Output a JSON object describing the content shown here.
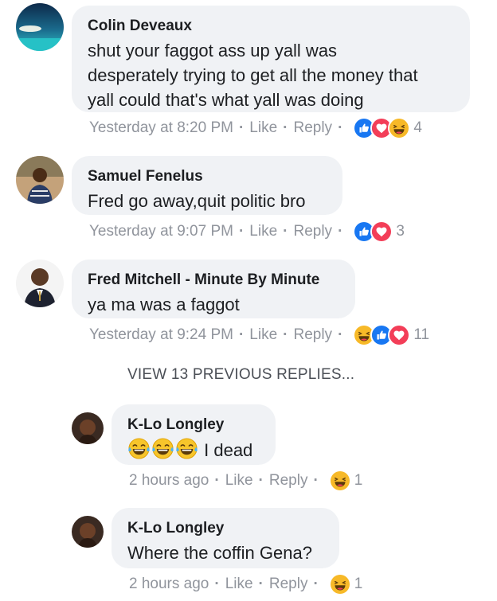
{
  "comments": [
    {
      "author": "Colin Deveaux",
      "text_lines": [
        "shut your faggot ass up yall was",
        "desperately trying to get all the money that",
        "yall could that's what yall was doing"
      ],
      "time": "Yesterday at 8:20 PM",
      "like": "Like",
      "reply": "Reply",
      "reactions": [
        "like",
        "love",
        "haha"
      ],
      "count": "4"
    },
    {
      "author": "Samuel Fenelus",
      "text_lines": [
        "Fred go away,quit politic bro"
      ],
      "time": "Yesterday at 9:07 PM",
      "like": "Like",
      "reply": "Reply",
      "reactions": [
        "like",
        "love"
      ],
      "count": "3"
    },
    {
      "author": "Fred Mitchell - Minute By Minute",
      "text_lines": [
        "ya ma was a faggot"
      ],
      "time": "Yesterday at 9:24 PM",
      "like": "Like",
      "reply": "Reply",
      "reactions": [
        "haha",
        "like",
        "love"
      ],
      "count": "11"
    }
  ],
  "view_previous": "VIEW 13 PREVIOUS REPLIES...",
  "replies": [
    {
      "author": "K-Lo Longley",
      "text": "I dead",
      "leading_emoji": [
        "laughing-tears",
        "laughing-tears",
        "laughing-tears"
      ],
      "time": "2 hours ago",
      "like": "Like",
      "reply": "Reply",
      "reactions": [
        "haha"
      ],
      "count": "1"
    },
    {
      "author": "K-Lo Longley",
      "text": "Where the coffin Gena?",
      "time": "2 hours ago",
      "like": "Like",
      "reply": "Reply",
      "reactions": [
        "haha"
      ],
      "count": "1"
    }
  ],
  "colors": {
    "bubble": "#f0f2f5",
    "meta": "#90949c",
    "like_blue": "#1877f2",
    "love_red": "#f33e58",
    "haha_yellow": "#f7b928"
  }
}
